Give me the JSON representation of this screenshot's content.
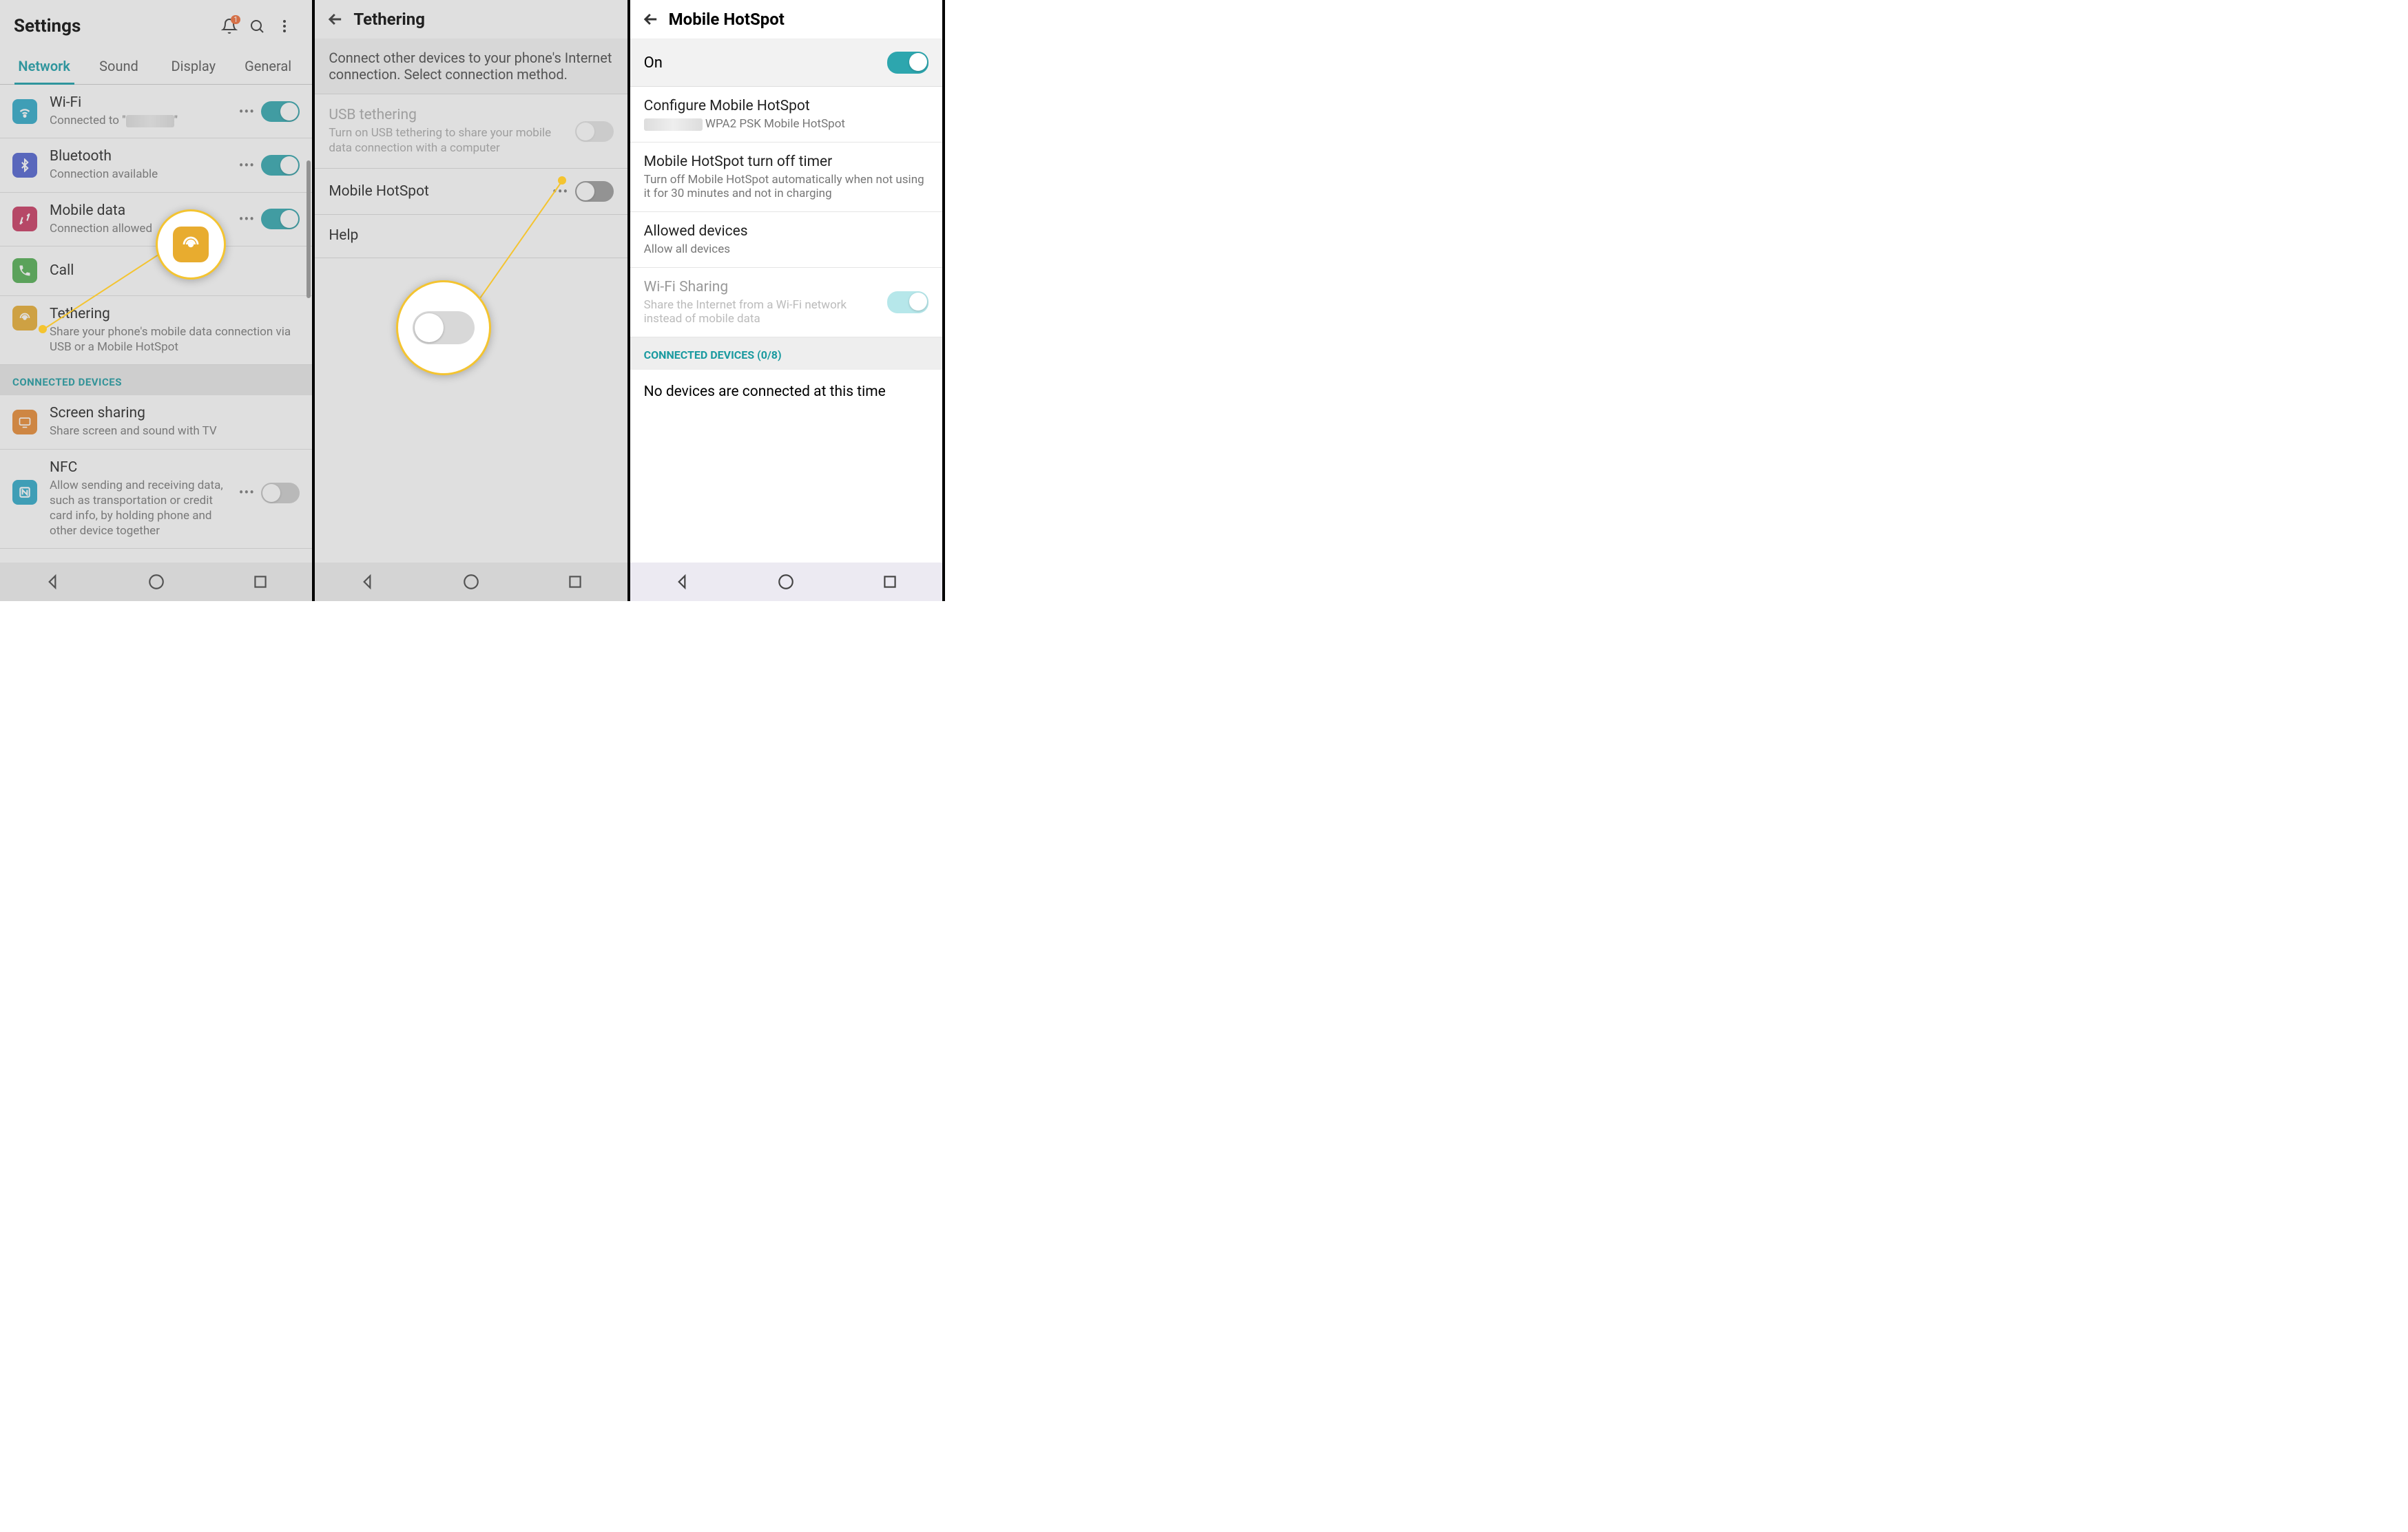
{
  "panel1": {
    "title": "Settings",
    "notification_badge": "1",
    "tabs": [
      "Network",
      "Sound",
      "Display",
      "General"
    ],
    "active_tab": 0,
    "items": {
      "wifi": {
        "title": "Wi-Fi",
        "sub_prefix": "Connected to \"",
        "sub_suffix": "\"",
        "toggle": true
      },
      "bluetooth": {
        "title": "Bluetooth",
        "sub": "Connection available",
        "toggle": true
      },
      "mobile_data": {
        "title": "Mobile data",
        "sub": "Connection allowed",
        "toggle": true
      },
      "call": {
        "title": "Call"
      },
      "tethering": {
        "title": "Tethering",
        "sub": "Share your phone's mobile data connection via USB or a Mobile HotSpot"
      }
    },
    "section_connected": "CONNECTED DEVICES",
    "items2": {
      "screen_sharing": {
        "title": "Screen sharing",
        "sub": "Share screen and sound with TV"
      },
      "nfc": {
        "title": "NFC",
        "sub": "Allow sending and receiving data, such as transportation or credit card info, by holding phone and other device together",
        "toggle": false
      }
    }
  },
  "panel2": {
    "title": "Tethering",
    "desc": "Connect other devices to your phone's Internet connection. Select connection method.",
    "usb": {
      "title": "USB tethering",
      "sub": "Turn on USB tethering to share your mobile data connection with a computer"
    },
    "hotspot": {
      "title": "Mobile HotSpot"
    },
    "help": {
      "title": "Help"
    }
  },
  "panel3": {
    "title": "Mobile HotSpot",
    "on_label": "On",
    "configure": {
      "title": "Configure Mobile HotSpot",
      "sub_suffix": "WPA2 PSK Mobile HotSpot"
    },
    "timer": {
      "title": "Mobile HotSpot turn off timer",
      "sub": "Turn off Mobile HotSpot automatically when not using it for 30 minutes and not in charging"
    },
    "allowed": {
      "title": "Allowed devices",
      "sub": "Allow all devices"
    },
    "wifi_sharing": {
      "title": "Wi-Fi Sharing",
      "sub": "Share the Internet from a Wi-Fi network instead of mobile data"
    },
    "connected_header": "CONNECTED DEVICES (0/8)",
    "no_devices": "No devices are connected at this time"
  }
}
